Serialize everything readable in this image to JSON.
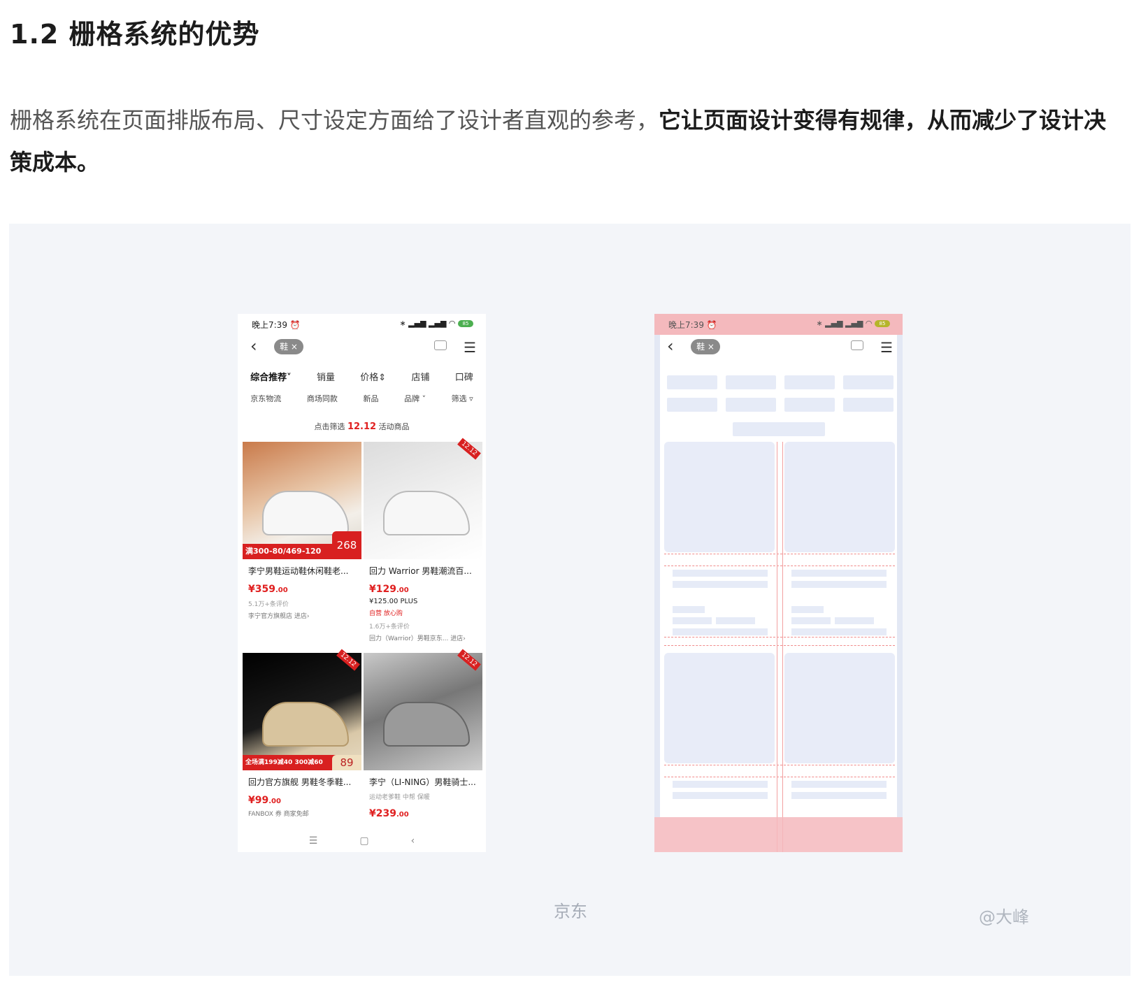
{
  "heading": "1.2 栅格系统的优势",
  "paragraph": {
    "normal": "栅格系统在页面排版布局、尺寸设定方面给了设计者直观的参考，",
    "bold": "它让页面设计变得有规律，从而减少了设计决策成本。"
  },
  "phone": {
    "time": "晚上7:39 ⏰",
    "status_icons": "∗ ▂▄▆ ▂▄▆ ◠",
    "battery": "85",
    "search_chip": "鞋 ×",
    "tabs": [
      "综合推荐˅",
      "销量",
      "价格⇕",
      "店铺",
      "口碑"
    ],
    "filters": [
      "京东物流",
      "商场同款",
      "新品",
      "品牌 ˅",
      "筛选 ▿"
    ],
    "promo_prefix": "点击筛选",
    "promo_badge": "12.12",
    "promo_suffix": "活动商品",
    "products": [
      {
        "title": "李宁男鞋运动鞋休闲鞋老...",
        "price": "¥359",
        "price_dec": ".00",
        "banner": "满300-80/469-120",
        "badge": "268",
        "meta": "5.1万+条评价",
        "meta2": "李宁官方旗舰店  进店›"
      },
      {
        "title": "回力 Warrior 男鞋潮流百...",
        "price": "¥129",
        "price_dec": ".00",
        "ribbon": "12.12",
        "plus": "¥125.00 PLUS",
        "tags": "自营  放心购",
        "meta": "1.6万+条评价",
        "meta2": "回力（Warrior）男鞋京东...  进店›"
      },
      {
        "title": "回力官方旗舰 男鞋冬季鞋...",
        "price": "¥99",
        "price_dec": ".00",
        "banner": "全场满199减40 300减60",
        "badge": "89",
        "ribbon": "12.12",
        "tags": "FANBOX  券  商家免邮"
      },
      {
        "title": "李宁（LI-NING）男鞋骑士...",
        "price": "¥239",
        "price_dec": ".00",
        "ribbon": "12.12",
        "meta": "运动老爹鞋    中帮    保暖"
      }
    ],
    "sysnav": [
      "☰",
      "▢",
      "‹"
    ]
  },
  "caption": "京东",
  "watermark": "@大峰"
}
